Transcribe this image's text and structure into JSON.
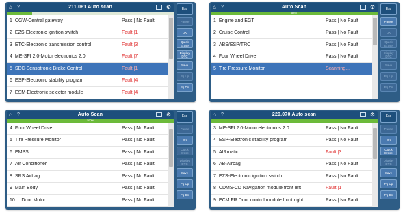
{
  "panels": [
    {
      "title": "211.061   Auto scan",
      "progress": 0.15,
      "progress_text": "",
      "rows": [
        {
          "num": "1",
          "name": "CGW-Central gateway",
          "result": "Pass | No Fault",
          "fault": false,
          "selected": false
        },
        {
          "num": "2",
          "name": "EZS-Electronic ignition switch",
          "result": "Fault |1",
          "fault": true,
          "selected": false
        },
        {
          "num": "3",
          "name": "ETC-Electronic transmission control",
          "result": "Fault |3",
          "fault": true,
          "selected": false
        },
        {
          "num": "4",
          "name": "ME-SFI 2.0-Motor electronics 2.0",
          "result": "Fault |7",
          "fault": true,
          "selected": false
        },
        {
          "num": "5",
          "name": "SBC-Sensotronic Brake Control",
          "result": "Fault |1",
          "fault": true,
          "selected": true
        },
        {
          "num": "6",
          "name": "ESP-Electronic stability program",
          "result": "Fault |4",
          "fault": true,
          "selected": false
        },
        {
          "num": "7",
          "name": "ESM-Electronic selector module",
          "result": "Fault |4",
          "fault": true,
          "selected": false
        }
      ],
      "buttons": [
        "Esc",
        "Pause",
        "OK",
        "Quick Erase",
        "Display DTC",
        "Save",
        "Pg Up",
        "Pg Dn"
      ],
      "dim": [
        false,
        true,
        false,
        false,
        false,
        false,
        true,
        false
      ]
    },
    {
      "title": "Auto Scan",
      "progress": 1.0,
      "progress_text": "88%",
      "rows": [
        {
          "num": "1",
          "name": "Engine and EGT",
          "result": "Pass | No Fault",
          "fault": false,
          "selected": false
        },
        {
          "num": "2",
          "name": "Cruise Control",
          "result": "Pass | No Fault",
          "fault": false,
          "selected": false
        },
        {
          "num": "3",
          "name": "ABS/ESP/TRC",
          "result": "Pass | No Fault",
          "fault": false,
          "selected": false
        },
        {
          "num": "4",
          "name": "Four Wheel Drive",
          "result": "Pass | No Fault",
          "fault": false,
          "selected": false
        },
        {
          "num": "5",
          "name": "Tire Pressure Monitor",
          "result": "Scanning...",
          "fault": false,
          "selected": true
        }
      ],
      "buttons": [
        "Esc",
        "Pause",
        "OK",
        "Quick Erase",
        "Display DTC",
        "Save",
        "Pg Up",
        "Pg Dn"
      ],
      "dim": [
        false,
        false,
        true,
        true,
        true,
        true,
        true,
        true
      ]
    },
    {
      "title": "Auto Scan",
      "progress": 1.0,
      "progress_text": "100%",
      "rows": [
        {
          "num": "4",
          "name": "Four Wheel Drive",
          "result": "Pass | No Fault",
          "fault": false,
          "selected": false
        },
        {
          "num": "5",
          "name": "Tire Pressure Monitor",
          "result": "Pass | No Fault",
          "fault": false,
          "selected": false
        },
        {
          "num": "6",
          "name": "EMPS",
          "result": "Pass | No Fault",
          "fault": false,
          "selected": false
        },
        {
          "num": "7",
          "name": "Air Conditioner",
          "result": "Pass | No Fault",
          "fault": false,
          "selected": false
        },
        {
          "num": "8",
          "name": "SRS Airbag",
          "result": "Pass | No Fault",
          "fault": false,
          "selected": false
        },
        {
          "num": "9",
          "name": "Main Body",
          "result": "Pass | No Fault",
          "fault": false,
          "selected": false
        },
        {
          "num": "10",
          "name": "L Door Motor",
          "result": "Pass | No Fault",
          "fault": false,
          "selected": false
        }
      ],
      "buttons": [
        "Esc",
        "Pause",
        "OK",
        "Quick Erase",
        "Display DTC",
        "Save",
        "Pg Up",
        "Pg Dn"
      ],
      "dim": [
        false,
        true,
        false,
        true,
        true,
        false,
        false,
        false
      ]
    },
    {
      "title": "229.070   Auto scan",
      "progress": 1.0,
      "progress_text": "",
      "rows": [
        {
          "num": "3",
          "name": "ME-SFI 2.0-Motor electronics 2.0",
          "result": "Pass | No Fault",
          "fault": false,
          "selected": false
        },
        {
          "num": "4",
          "name": "ESP-Electronic stability program",
          "result": "Pass | No Fault",
          "fault": false,
          "selected": false
        },
        {
          "num": "5",
          "name": "AIRmatic",
          "result": "Fault |3",
          "fault": true,
          "selected": false
        },
        {
          "num": "6",
          "name": "AB-Airbag",
          "result": "Pass | No Fault",
          "fault": false,
          "selected": false
        },
        {
          "num": "7",
          "name": "EZS-Electronic ignition switch",
          "result": "Pass | No Fault",
          "fault": false,
          "selected": false
        },
        {
          "num": "8",
          "name": "CDMS-CD Navigation module front left",
          "result": "Fault |1",
          "fault": true,
          "selected": false
        },
        {
          "num": "9",
          "name": "ECM FR Door control module front right",
          "result": "Pass | No Fault",
          "fault": false,
          "selected": false
        }
      ],
      "buttons": [
        "Esc",
        "Pause",
        "OK",
        "Quick Erase",
        "Display DTC",
        "Save",
        "Pg Up",
        "Pg Dn"
      ],
      "dim": [
        false,
        true,
        false,
        false,
        true,
        false,
        false,
        false
      ]
    }
  ]
}
